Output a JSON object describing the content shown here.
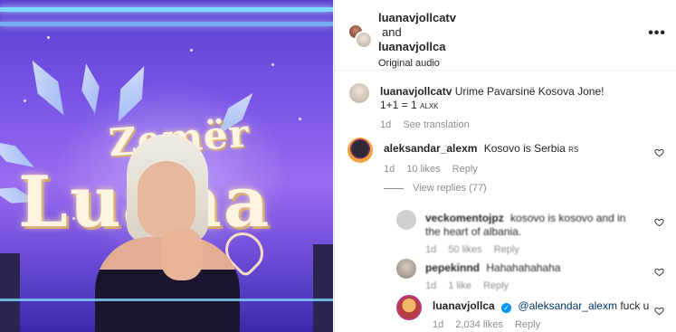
{
  "header": {
    "user_primary": "luanavjollcatv",
    "and_text": "and",
    "user_secondary": "luanavjollca",
    "audio_label": "Original audio",
    "more_label": "•••"
  },
  "media": {
    "logo_top": "Zemër",
    "logo_main": "Luana"
  },
  "caption": {
    "username": "luanavjollcatv",
    "text": "Urime Pavarsinë Kosova Jone!",
    "line2_main": "1+1 = 1",
    "line2_small": "ALXK",
    "time": "1d",
    "see_translation": "See translation"
  },
  "comments": [
    {
      "username": "aleksandar_alexm",
      "text": "Kosovo is Serbia",
      "flag_text": "RS",
      "time": "1d",
      "likes": "10 likes",
      "reply": "Reply"
    }
  ],
  "view_replies": "View replies (77)",
  "replies": [
    {
      "username": "veckomentojpz",
      "text": "kosovo is kosovo and in the heart of albania.",
      "time": "1d",
      "likes": "50 likes",
      "reply": "Reply"
    },
    {
      "username": "pepekinnd",
      "text": "Hahahahahaha",
      "time": "1d",
      "likes": "1 like",
      "reply": "Reply"
    },
    {
      "username": "luanavjollca",
      "verified": true,
      "mention": "@aleksandar_alexm",
      "text": "fuck u",
      "time": "1d",
      "likes": "2,034 likes",
      "reply": "Reply"
    }
  ],
  "colors": {
    "link_blue": "#00376b",
    "verified_blue": "#0095f6",
    "muted_text": "#8e8e8e"
  }
}
